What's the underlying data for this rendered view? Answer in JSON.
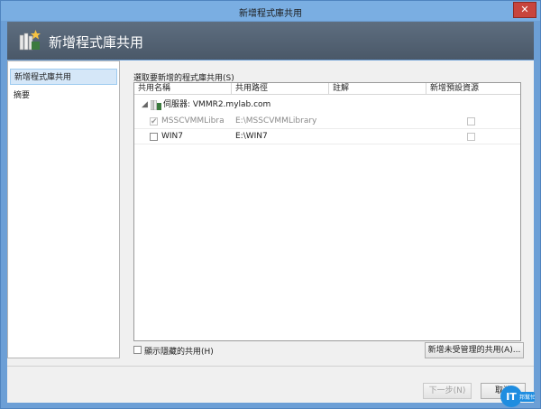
{
  "window": {
    "title": "新增程式庫共用",
    "close_label": "✕"
  },
  "banner": {
    "title": "新增程式庫共用",
    "icon": "library-share-wizard-icon"
  },
  "nav": {
    "items": [
      {
        "label": "新增程式庫共用",
        "selected": true
      },
      {
        "label": "摘要",
        "selected": false
      }
    ]
  },
  "main": {
    "label": "選取要新增的程式庫共用(S)"
  },
  "grid": {
    "columns": [
      "共用名稱",
      "共用路徑",
      "註解",
      "新增預設資源"
    ],
    "server_label": "伺服器: VMMR2.mylab.com",
    "rows": [
      {
        "name": "MSSCVMMLibra",
        "path": "E:\\MSSCVMMLibrary",
        "comment": "",
        "checked": true,
        "disabled": true,
        "default_resources": false
      },
      {
        "name": "WIN7",
        "path": "E:\\WIN7",
        "comment": "",
        "checked": false,
        "disabled": false,
        "default_resources": false
      }
    ]
  },
  "footer": {
    "show_hidden_label": "顯示隱藏的共用(H)",
    "show_hidden_checked": false,
    "add_unmanaged_label": "新增未受管理的共用(A)...",
    "next_label": "下一步(N)",
    "cancel_label": "取消"
  },
  "logo": {
    "text_main": "IT",
    "text_sub": "邦幫忙",
    "accent": "#1f8de0"
  }
}
